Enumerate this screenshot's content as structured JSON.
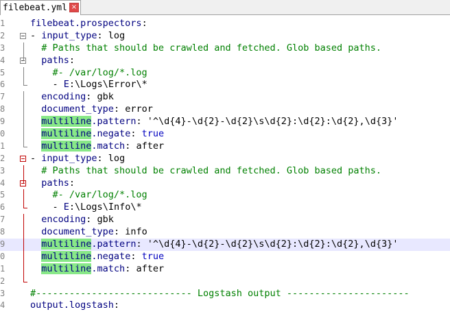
{
  "tab": {
    "filename": "filebeat.yml",
    "close_icon": "×"
  },
  "lines": [
    {
      "n": "1",
      "text": "filebeat.prospectors:"
    },
    {
      "n": "2",
      "text": "- input_type: log"
    },
    {
      "n": "3",
      "text": "  # Paths that should be crawled and fetched. Glob based paths."
    },
    {
      "n": "4",
      "text": "  paths:"
    },
    {
      "n": "5",
      "text": "    #- /var/log/*.log"
    },
    {
      "n": "6",
      "text": "    - E:\\Logs\\Error\\*"
    },
    {
      "n": "7",
      "text": "  encoding: gbk"
    },
    {
      "n": "8",
      "text": "  document_type: error"
    },
    {
      "n": "9",
      "text": "  multiline.pattern: '^\\d{4}-\\d{2}-\\d{2}\\s\\d{2}:\\d{2}:\\d{2},\\d{3}'"
    },
    {
      "n": "0",
      "text": "  multiline.negate: true"
    },
    {
      "n": "1",
      "text": "  multiline.match: after"
    },
    {
      "n": "2",
      "text": "- input_type: log"
    },
    {
      "n": "3",
      "text": "  # Paths that should be crawled and fetched. Glob based paths."
    },
    {
      "n": "4",
      "text": "  paths:"
    },
    {
      "n": "5",
      "text": "    #- /var/log/*.log"
    },
    {
      "n": "6",
      "text": "    - E:\\Logs\\Info\\*"
    },
    {
      "n": "7",
      "text": "  encoding: gbk"
    },
    {
      "n": "8",
      "text": "  document_type: info"
    },
    {
      "n": "9",
      "text": "  multiline.pattern: '^\\d{4}-\\d{2}-\\d{2}\\s\\d{2}:\\d{2}:\\d{2},\\d{3}'"
    },
    {
      "n": "0",
      "text": "  multiline.negate: true"
    },
    {
      "n": "1",
      "text": "  multiline.match: after"
    },
    {
      "n": "2",
      "text": ""
    },
    {
      "n": "3",
      "text": "#---------------------------- Logstash output ----------------------"
    },
    {
      "n": "4",
      "text": "output.logstash:"
    }
  ],
  "highlight_word": "multiline",
  "colors": {
    "keyword": "#000080",
    "comment": "#008000",
    "bool": "#0000c0",
    "highlight": "#88e888",
    "current_line": "#e8e8ff",
    "fold_red": "#c00000"
  }
}
